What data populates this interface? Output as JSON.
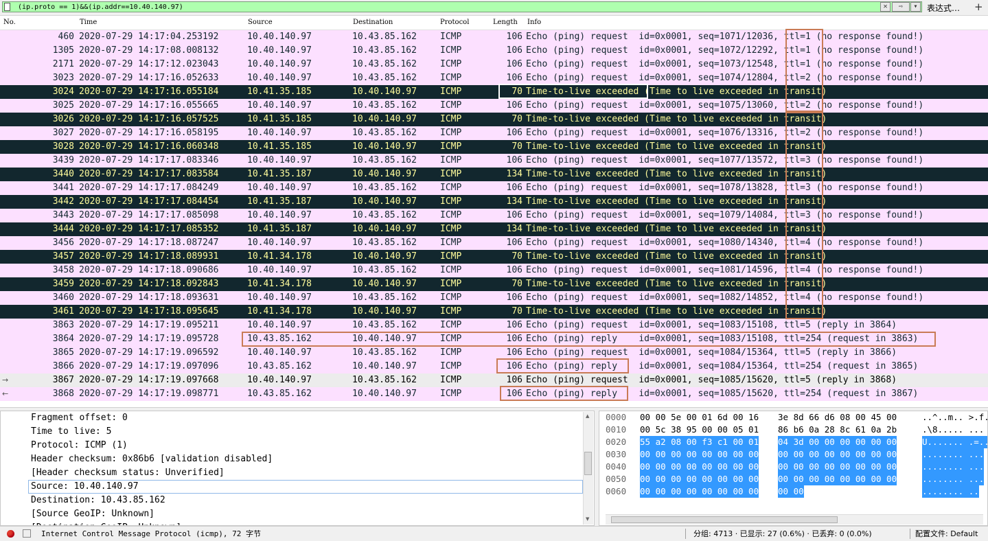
{
  "filter": {
    "value": "(ip.proto == 1)&&(ip.addr==10.40.140.97)",
    "clear_glyph": "✕",
    "apply_glyph": "⇨",
    "dropdown_glyph": "▾",
    "expression_label": "表达式…",
    "add_glyph": "+"
  },
  "columns": [
    "No.",
    "Time",
    "Source",
    "Destination",
    "Protocol",
    "Length",
    "Info"
  ],
  "packets": [
    {
      "no": "460",
      "time": "2020-07-29 14:17:04.253192",
      "src": "10.40.140.97",
      "dst": "10.43.85.162",
      "proto": "ICMP",
      "len": "106",
      "info": "Echo (ping) request  id=0x0001, seq=1071/12036, ttl=1 (no response found!)",
      "style": "req"
    },
    {
      "no": "1305",
      "time": "2020-07-29 14:17:08.008132",
      "src": "10.40.140.97",
      "dst": "10.43.85.162",
      "proto": "ICMP",
      "len": "106",
      "info": "Echo (ping) request  id=0x0001, seq=1072/12292, ttl=1 (no response found!)",
      "style": "req"
    },
    {
      "no": "2171",
      "time": "2020-07-29 14:17:12.023043",
      "src": "10.40.140.97",
      "dst": "10.43.85.162",
      "proto": "ICMP",
      "len": "106",
      "info": "Echo (ping) request  id=0x0001, seq=1073/12548, ttl=1 (no response found!)",
      "style": "req"
    },
    {
      "no": "3023",
      "time": "2020-07-29 14:17:16.052633",
      "src": "10.40.140.97",
      "dst": "10.43.85.162",
      "proto": "ICMP",
      "len": "106",
      "info": "Echo (ping) request  id=0x0001, seq=1074/12804, ttl=2 (no response found!)",
      "style": "req"
    },
    {
      "no": "3024",
      "time": "2020-07-29 14:17:16.055184",
      "src": "10.41.35.185",
      "dst": "10.40.140.97",
      "proto": "ICMP",
      "len": "70",
      "info": "Time-to-live exceeded (Time to live exceeded in transit)",
      "style": "ttl"
    },
    {
      "no": "3025",
      "time": "2020-07-29 14:17:16.055665",
      "src": "10.40.140.97",
      "dst": "10.43.85.162",
      "proto": "ICMP",
      "len": "106",
      "info": "Echo (ping) request  id=0x0001, seq=1075/13060, ttl=2 (no response found!)",
      "style": "req"
    },
    {
      "no": "3026",
      "time": "2020-07-29 14:17:16.057525",
      "src": "10.41.35.185",
      "dst": "10.40.140.97",
      "proto": "ICMP",
      "len": "70",
      "info": "Time-to-live exceeded (Time to live exceeded in transit)",
      "style": "ttl"
    },
    {
      "no": "3027",
      "time": "2020-07-29 14:17:16.058195",
      "src": "10.40.140.97",
      "dst": "10.43.85.162",
      "proto": "ICMP",
      "len": "106",
      "info": "Echo (ping) request  id=0x0001, seq=1076/13316, ttl=2 (no response found!)",
      "style": "req"
    },
    {
      "no": "3028",
      "time": "2020-07-29 14:17:16.060348",
      "src": "10.41.35.185",
      "dst": "10.40.140.97",
      "proto": "ICMP",
      "len": "70",
      "info": "Time-to-live exceeded (Time to live exceeded in transit)",
      "style": "ttl"
    },
    {
      "no": "3439",
      "time": "2020-07-29 14:17:17.083346",
      "src": "10.40.140.97",
      "dst": "10.43.85.162",
      "proto": "ICMP",
      "len": "106",
      "info": "Echo (ping) request  id=0x0001, seq=1077/13572, ttl=3 (no response found!)",
      "style": "req"
    },
    {
      "no": "3440",
      "time": "2020-07-29 14:17:17.083584",
      "src": "10.41.35.187",
      "dst": "10.40.140.97",
      "proto": "ICMP",
      "len": "134",
      "info": "Time-to-live exceeded (Time to live exceeded in transit)",
      "style": "ttl"
    },
    {
      "no": "3441",
      "time": "2020-07-29 14:17:17.084249",
      "src": "10.40.140.97",
      "dst": "10.43.85.162",
      "proto": "ICMP",
      "len": "106",
      "info": "Echo (ping) request  id=0x0001, seq=1078/13828, ttl=3 (no response found!)",
      "style": "req"
    },
    {
      "no": "3442",
      "time": "2020-07-29 14:17:17.084454",
      "src": "10.41.35.187",
      "dst": "10.40.140.97",
      "proto": "ICMP",
      "len": "134",
      "info": "Time-to-live exceeded (Time to live exceeded in transit)",
      "style": "ttl"
    },
    {
      "no": "3443",
      "time": "2020-07-29 14:17:17.085098",
      "src": "10.40.140.97",
      "dst": "10.43.85.162",
      "proto": "ICMP",
      "len": "106",
      "info": "Echo (ping) request  id=0x0001, seq=1079/14084, ttl=3 (no response found!)",
      "style": "req"
    },
    {
      "no": "3444",
      "time": "2020-07-29 14:17:17.085352",
      "src": "10.41.35.187",
      "dst": "10.40.140.97",
      "proto": "ICMP",
      "len": "134",
      "info": "Time-to-live exceeded (Time to live exceeded in transit)",
      "style": "ttl"
    },
    {
      "no": "3456",
      "time": "2020-07-29 14:17:18.087247",
      "src": "10.40.140.97",
      "dst": "10.43.85.162",
      "proto": "ICMP",
      "len": "106",
      "info": "Echo (ping) request  id=0x0001, seq=1080/14340, ttl=4 (no response found!)",
      "style": "req"
    },
    {
      "no": "3457",
      "time": "2020-07-29 14:17:18.089931",
      "src": "10.41.34.178",
      "dst": "10.40.140.97",
      "proto": "ICMP",
      "len": "70",
      "info": "Time-to-live exceeded (Time to live exceeded in transit)",
      "style": "ttl"
    },
    {
      "no": "3458",
      "time": "2020-07-29 14:17:18.090686",
      "src": "10.40.140.97",
      "dst": "10.43.85.162",
      "proto": "ICMP",
      "len": "106",
      "info": "Echo (ping) request  id=0x0001, seq=1081/14596, ttl=4 (no response found!)",
      "style": "req"
    },
    {
      "no": "3459",
      "time": "2020-07-29 14:17:18.092843",
      "src": "10.41.34.178",
      "dst": "10.40.140.97",
      "proto": "ICMP",
      "len": "70",
      "info": "Time-to-live exceeded (Time to live exceeded in transit)",
      "style": "ttl"
    },
    {
      "no": "3460",
      "time": "2020-07-29 14:17:18.093631",
      "src": "10.40.140.97",
      "dst": "10.43.85.162",
      "proto": "ICMP",
      "len": "106",
      "info": "Echo (ping) request  id=0x0001, seq=1082/14852, ttl=4 (no response found!)",
      "style": "req"
    },
    {
      "no": "3461",
      "time": "2020-07-29 14:17:18.095645",
      "src": "10.41.34.178",
      "dst": "10.40.140.97",
      "proto": "ICMP",
      "len": "70",
      "info": "Time-to-live exceeded (Time to live exceeded in transit)",
      "style": "ttl"
    },
    {
      "no": "3863",
      "time": "2020-07-29 14:17:19.095211",
      "src": "10.40.140.97",
      "dst": "10.43.85.162",
      "proto": "ICMP",
      "len": "106",
      "info": "Echo (ping) request  id=0x0001, seq=1083/15108, ttl=5 (reply in 3864)",
      "style": "req"
    },
    {
      "no": "3864",
      "time": "2020-07-29 14:17:19.095728",
      "src": "10.43.85.162",
      "dst": "10.40.140.97",
      "proto": "ICMP",
      "len": "106",
      "info": "Echo (ping) reply    id=0x0001, seq=1083/15108, ttl=254 (request in 3863)",
      "style": "req"
    },
    {
      "no": "3865",
      "time": "2020-07-29 14:17:19.096592",
      "src": "10.40.140.97",
      "dst": "10.43.85.162",
      "proto": "ICMP",
      "len": "106",
      "info": "Echo (ping) request  id=0x0001, seq=1084/15364, ttl=5 (reply in 3866)",
      "style": "req"
    },
    {
      "no": "3866",
      "time": "2020-07-29 14:17:19.097096",
      "src": "10.43.85.162",
      "dst": "10.40.140.97",
      "proto": "ICMP",
      "len": "106",
      "info": "Echo (ping) reply    id=0x0001, seq=1084/15364, ttl=254 (request in 3865)",
      "style": "req"
    },
    {
      "no": "3867",
      "time": "2020-07-29 14:17:19.097668",
      "src": "10.40.140.97",
      "dst": "10.43.85.162",
      "proto": "ICMP",
      "len": "106",
      "info": "Echo (ping) request  id=0x0001, seq=1085/15620, ttl=5 (reply in 3868)",
      "style": "sel",
      "arrow": "→"
    },
    {
      "no": "3868",
      "time": "2020-07-29 14:17:19.098771",
      "src": "10.43.85.162",
      "dst": "10.40.140.97",
      "proto": "ICMP",
      "len": "106",
      "info": "Echo (ping) reply    id=0x0001, seq=1085/15620, ttl=254 (request in 3867)",
      "style": "req",
      "arrow": "←"
    }
  ],
  "details": [
    "Fragment offset: 0",
    "Time to live: 5",
    "Protocol: ICMP (1)",
    "Header checksum: 0x86b6 [validation disabled]",
    "[Header checksum status: Unverified]",
    "Source: 10.40.140.97",
    "Destination: 10.43.85.162",
    "[Source GeoIP: Unknown]",
    "[Destination GeoIP: Unknown]"
  ],
  "bytes": [
    {
      "off": "0000",
      "h1": "00 00 5e 00 01 6d 00 16",
      "h2": "3e 8d 66 d6 08 00 45 00",
      "ascii": "..^..m.. >.f..."
    },
    {
      "off": "0010",
      "h1": "00 5c 38 95 00 00 05 01",
      "h2": "86 b6 0a 28 8c 61 0a 2b",
      "ascii": ".\\8..... ..."
    },
    {
      "off": "0020",
      "h1": "55 a2 08 00 f3 c1 00 01",
      "h2": "04 3d 00 00 00 00 00 00",
      "ascii": "U....... .=..."
    },
    {
      "off": "0030",
      "h1": "00 00 00 00 00 00 00 00",
      "h2": "00 00 00 00 00 00 00 00",
      "ascii": "........ ..."
    },
    {
      "off": "0040",
      "h1": "00 00 00 00 00 00 00 00",
      "h2": "00 00 00 00 00 00 00 00",
      "ascii": "........ ..."
    },
    {
      "off": "0050",
      "h1": "00 00 00 00 00 00 00 00",
      "h2": "00 00 00 00 00 00 00 00",
      "ascii": "........ ..."
    },
    {
      "off": "0060",
      "h1": "00 00 00 00 00 00 00 00",
      "h2": "00 00",
      "ascii": "........ .."
    }
  ],
  "status": {
    "protocol_text": "Internet Control Message Protocol (icmp), 72 字节",
    "packets_text": "分组: 4713 · 已显示: 27 (0.6%) · 已丢弃: 0 (0.0%)",
    "profile_text": "配置文件: Default"
  },
  "colors": {
    "icmp_bg": "#fce0ff",
    "ttl_bg": "#12272e",
    "ttl_fg": "#fffc9c",
    "filter_ok": "#afffaf",
    "highlight_box": "#c97b55",
    "byte_selection": "#3399ff"
  }
}
